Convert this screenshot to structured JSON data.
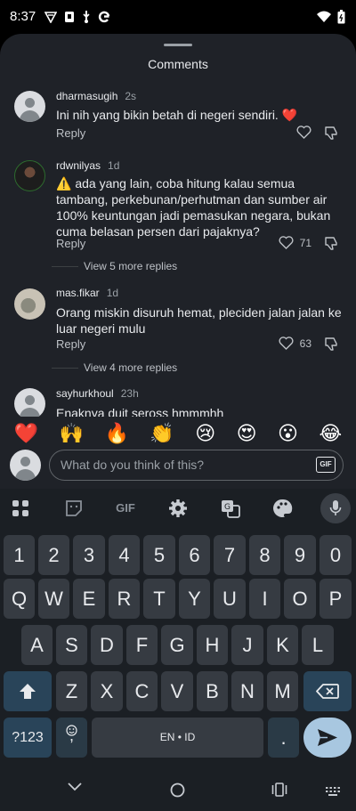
{
  "status_bar": {
    "time": "8:37",
    "icons": [
      "vpn-icon",
      "save-icon",
      "usb-icon",
      "google-icon"
    ],
    "right_icons": [
      "wifi-icon",
      "battery-icon"
    ]
  },
  "sheet": {
    "title": "Comments"
  },
  "comments": [
    {
      "user": "dharmasugih",
      "time": "2s",
      "text_lines": [
        "Ini nih yang bikin betah di negeri sendiri. ❤️"
      ],
      "reply": "Reply",
      "likes": ""
    },
    {
      "user": "rdwnilyas",
      "time": "1d",
      "text_lines": [
        "⚠️ ada yang lain, coba hitung kalau semua",
        "tambang, perkebunan/perhutman dan sumber air",
        "100% keuntungan jadi pemasukan negara, bukan",
        "cuma belasan persen dari pajaknya?"
      ],
      "reply": "Reply",
      "likes": "71",
      "view_more": "View 5 more replies"
    },
    {
      "user": "mas.fikar",
      "time": "1d",
      "text_lines": [
        "Orang miskin disuruh hemat, pleciden jalan jalan ke",
        "luar negeri mulu"
      ],
      "reply": "Reply",
      "likes": "63",
      "view_more": "View 4 more replies"
    },
    {
      "user": "sayhurkhoul",
      "time": "23h",
      "text_lines": [
        "Enaknya duit seross hmmmhh"
      ]
    }
  ],
  "emojis": [
    "❤️",
    "🙌",
    "🔥",
    "👏",
    "😢",
    "😍",
    "😮",
    "😂"
  ],
  "input": {
    "placeholder": "What do you think of this?",
    "gif_label": "GIF"
  },
  "keyboard": {
    "toolbar_gif": "GIF",
    "row_numbers": [
      "1",
      "2",
      "3",
      "4",
      "5",
      "6",
      "7",
      "8",
      "9",
      "0"
    ],
    "row1": [
      "Q",
      "W",
      "E",
      "R",
      "T",
      "Y",
      "U",
      "I",
      "O",
      "P"
    ],
    "row2": [
      "A",
      "S",
      "D",
      "F",
      "G",
      "H",
      "J",
      "K",
      "L"
    ],
    "row3": [
      "Z",
      "X",
      "C",
      "V",
      "B",
      "N",
      "M"
    ],
    "symbols_key": "?123",
    "comma_key": ",",
    "space_label": "EN • ID",
    "period_key": "."
  }
}
